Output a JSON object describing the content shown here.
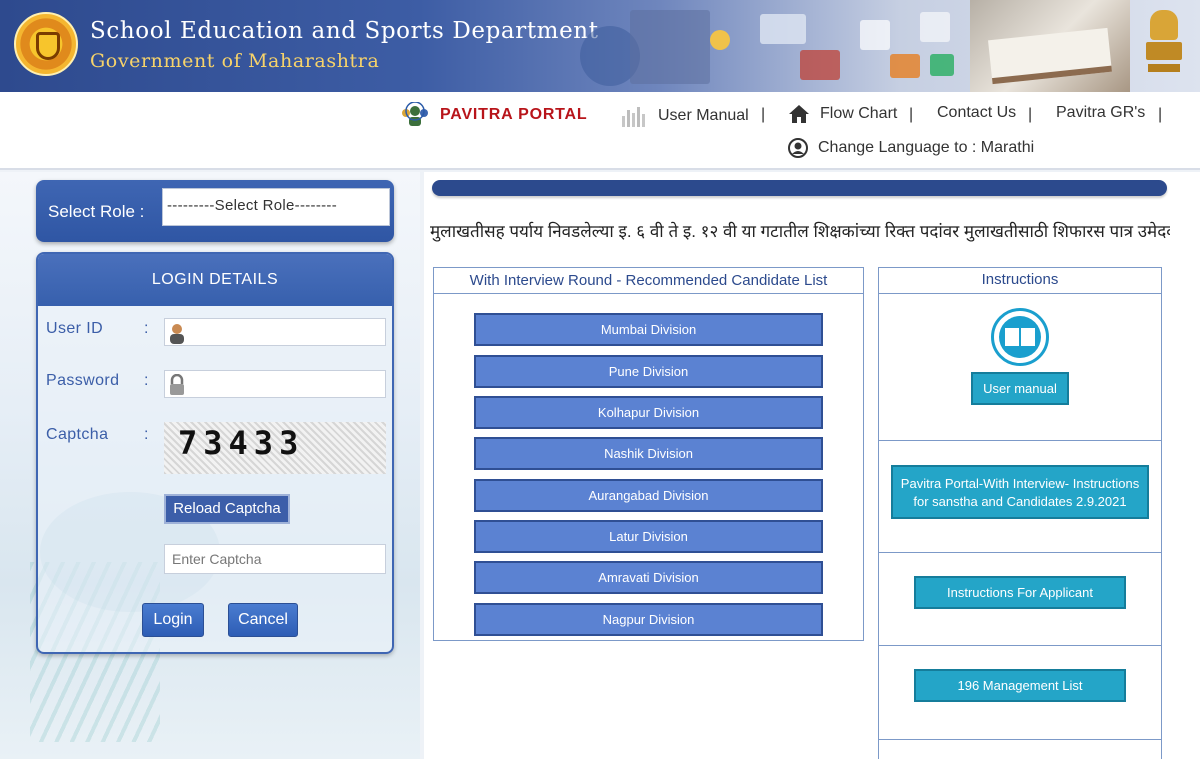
{
  "header": {
    "title": "School Education and Sports Department",
    "subtitle": "Government of Maharashtra"
  },
  "nav": {
    "portal_name": "PAVITRA PORTAL",
    "user_manual": "User Manual",
    "flow_chart": "Flow Chart",
    "contact_us": "Contact Us",
    "pavitra_grs": "Pavitra GR's",
    "change_language": "Change Language to : Marathi",
    "separator": "|"
  },
  "login": {
    "role_label": "Select Role :",
    "role_value": "---------Select Role--------",
    "panel_title": "LOGIN DETAILS",
    "user_id_label": "User ID",
    "password_label": "Password",
    "captcha_label": "Captcha",
    "colon": ":",
    "captcha_text": "73433",
    "reload_label": "Reload Captcha",
    "captcha_placeholder": "Enter Captcha",
    "login_label": "Login",
    "cancel_label": "Cancel"
  },
  "content": {
    "marquee_text": "मुलाखतीसह पर्याय निवडलेल्या इ. ६ वी ते इ. १२ वी या गटातील शिक्षकांच्या रिक्त पदांवर मुलाखतीसाठी शिफारस पात्र उमेदवा",
    "list_title": "With Interview Round - Recommended Candidate List",
    "divisions": [
      "Mumbai Division",
      "Pune Division",
      "Kolhapur Division",
      "Nashik Division",
      "Aurangabad Division",
      "Latur Division",
      "Amravati Division",
      "Nagpur Division"
    ],
    "instructions_title": "Instructions",
    "instr_user_manual": "User manual",
    "instr_sanstha": "Pavitra Portal-With Interview- Instructions for sanstha and Candidates 2.9.2021",
    "instr_applicant": "Instructions For Applicant",
    "instr_management": "196 Management List"
  },
  "colors": {
    "header_blue": "#2e4a8e",
    "button_blue": "#5b82d2",
    "teal": "#24a5c8",
    "portal_red": "#b8141a"
  }
}
